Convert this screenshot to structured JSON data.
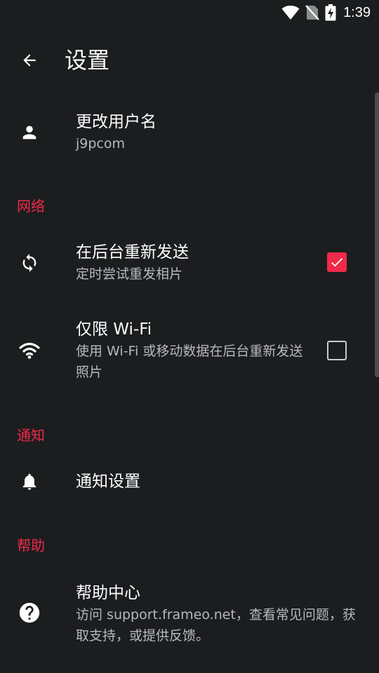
{
  "status_bar": {
    "time": "1:39",
    "icons": [
      "wifi-icon",
      "no-sim-icon",
      "battery-charging-icon"
    ]
  },
  "header": {
    "title": "设置",
    "back_icon": "arrow-back-icon"
  },
  "account": {
    "title": "更改用户名",
    "username": "j9pcom",
    "icon": "person-icon"
  },
  "sections": {
    "network": "网络",
    "notifications": "通知",
    "help": "帮助"
  },
  "network": {
    "resend": {
      "title": "在后台重新发送",
      "subtitle": "定时尝试重发相片",
      "checked": true,
      "icon": "sync-icon"
    },
    "wifi_only": {
      "title": "仅限 Wi-Fi",
      "subtitle": "使用 Wi-Fi 或移动数据在后台重新发送照片",
      "checked": false,
      "icon": "wifi-icon"
    }
  },
  "notifications": {
    "settings": {
      "title": "通知设置",
      "icon": "bell-icon"
    }
  },
  "help": {
    "center": {
      "title": "帮助中心",
      "subtitle": "访问 support.frameo.net，查看常见问题，获取支持，或提供反馈。",
      "icon": "help-circle-icon"
    }
  },
  "colors": {
    "background": "#1c1d1f",
    "accent": "#f02a4a",
    "text_primary": "#ffffff",
    "text_secondary": "#b7b9bc"
  }
}
